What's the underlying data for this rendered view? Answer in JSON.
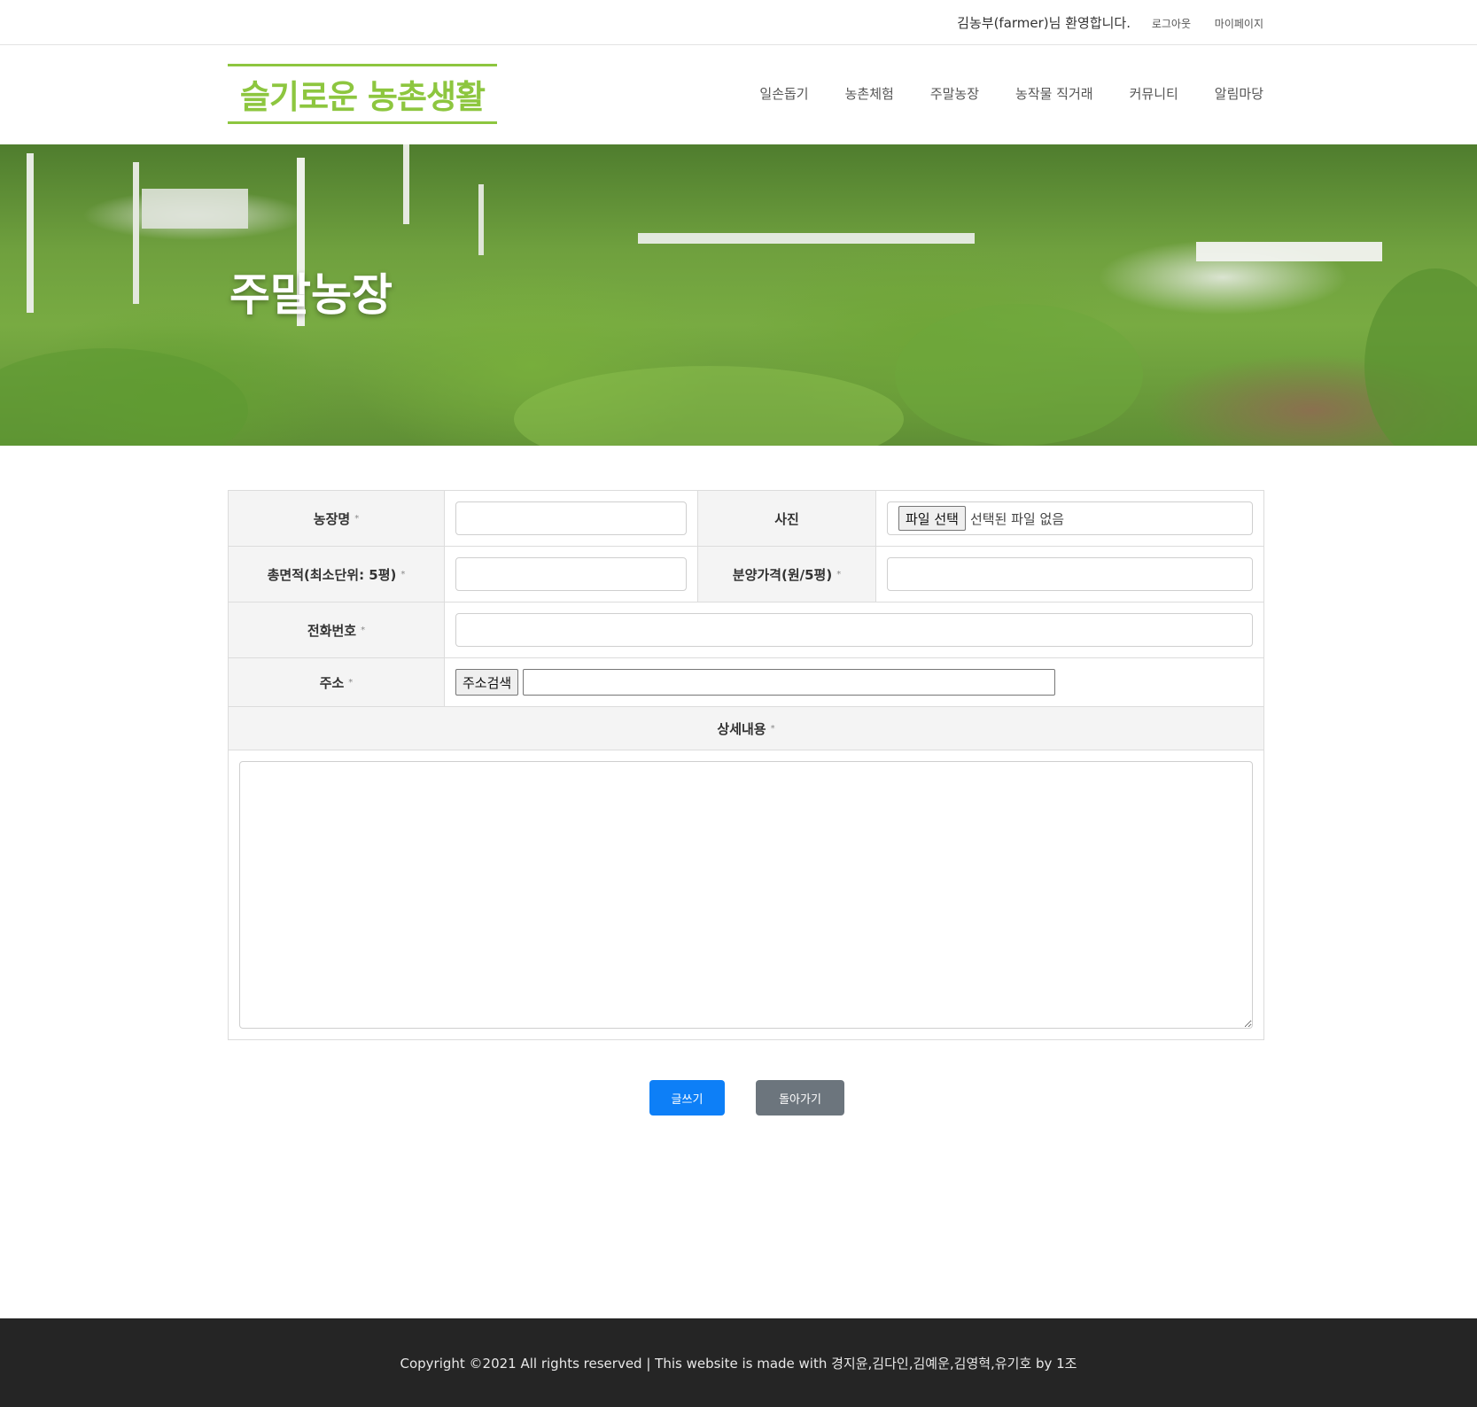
{
  "topbar": {
    "welcome": "김농부(farmer)님 환영합니다.",
    "logout": "로그아웃",
    "mypage": "마이페이지"
  },
  "header": {
    "logo": "슬기로운 농촌생활",
    "nav": [
      "일손돕기",
      "농촌체험",
      "주말농장",
      "농작물 직거래",
      "커뮤니티",
      "알림마당"
    ]
  },
  "hero": {
    "title": "주말농장"
  },
  "form": {
    "farm_name_label": "농장명",
    "photo_label": "사진",
    "file_button": "파일 선택",
    "file_status": "선택된 파일 없음",
    "area_label": "총면적(최소단위: 5평)",
    "price_label": "분양가격(원/5평)",
    "phone_label": "전화번호",
    "address_label": "주소",
    "address_button": "주소검색",
    "detail_label": "상세내용",
    "required_mark": "*"
  },
  "buttons": {
    "write": "글쓰기",
    "back": "돌아가기"
  },
  "footer": {
    "copyright": "Copyright ©2021 All rights reserved | This website is made with 경지윤,김다인,김예운,김영혁,유기호 by 1조"
  },
  "colors": {
    "brand_green": "#8dc63f",
    "primary_button": "#0d7ff7",
    "secondary_button": "#6c757d",
    "footer_bg": "#252525"
  }
}
